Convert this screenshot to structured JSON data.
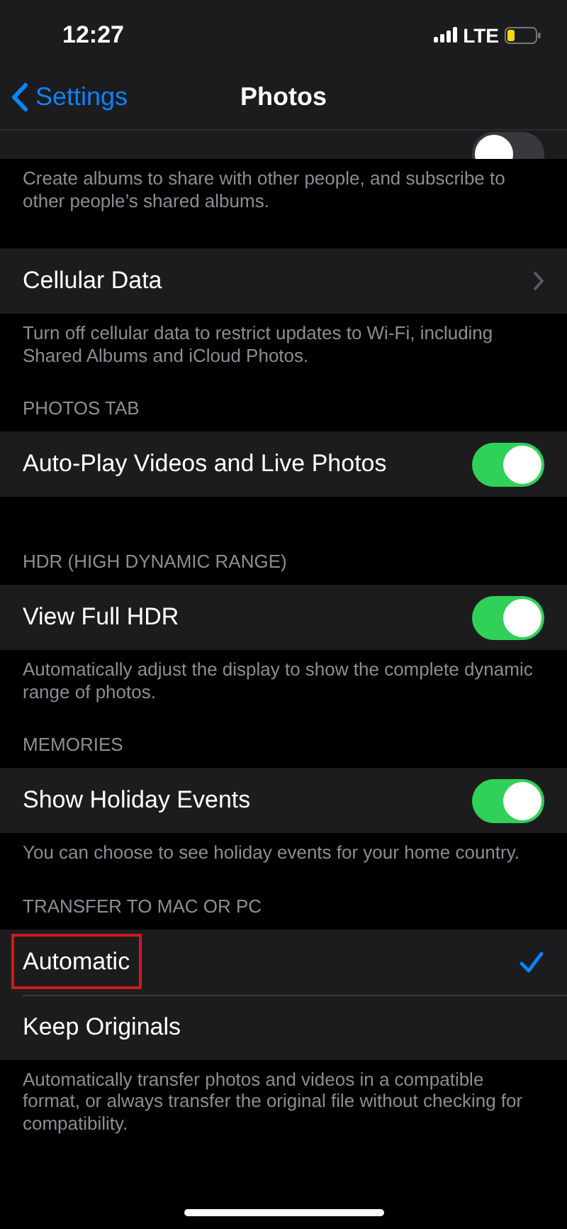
{
  "status_bar": {
    "time": "12:27",
    "network": "LTE"
  },
  "nav": {
    "back_label": "Settings",
    "title": "Photos"
  },
  "sections": [
    {
      "kind": "partial",
      "rows": [
        {
          "kind": "toggle",
          "on": false
        }
      ],
      "footer": "Create albums to share with other people, and subscribe to other people’s shared albums."
    },
    {
      "rows": [
        {
          "kind": "link",
          "label": "Cellular Data"
        }
      ],
      "footer": "Turn off cellular data to restrict updates to Wi-Fi, including Shared Albums and iCloud Photos."
    },
    {
      "header": "PHOTOS TAB",
      "rows": [
        {
          "kind": "toggle",
          "label": "Auto-Play Videos and Live Photos",
          "on": true
        }
      ]
    },
    {
      "header": "HDR (HIGH DYNAMIC RANGE)",
      "rows": [
        {
          "kind": "toggle",
          "label": "View Full HDR",
          "on": true
        }
      ],
      "footer": "Automatically adjust the display to show the complete dynamic range of photos."
    },
    {
      "header": "MEMORIES",
      "rows": [
        {
          "kind": "toggle",
          "label": "Show Holiday Events",
          "on": true
        }
      ],
      "footer": "You can choose to see holiday events for your home country."
    },
    {
      "header": "TRANSFER TO MAC OR PC",
      "rows": [
        {
          "kind": "option",
          "label": "Automatic",
          "selected": true,
          "highlighted": true
        },
        {
          "kind": "option",
          "label": "Keep Originals",
          "selected": false,
          "highlighted": false
        }
      ],
      "footer": "Automatically transfer photos and videos in a compatible format, or always transfer the original file without checking for compatibility."
    }
  ]
}
